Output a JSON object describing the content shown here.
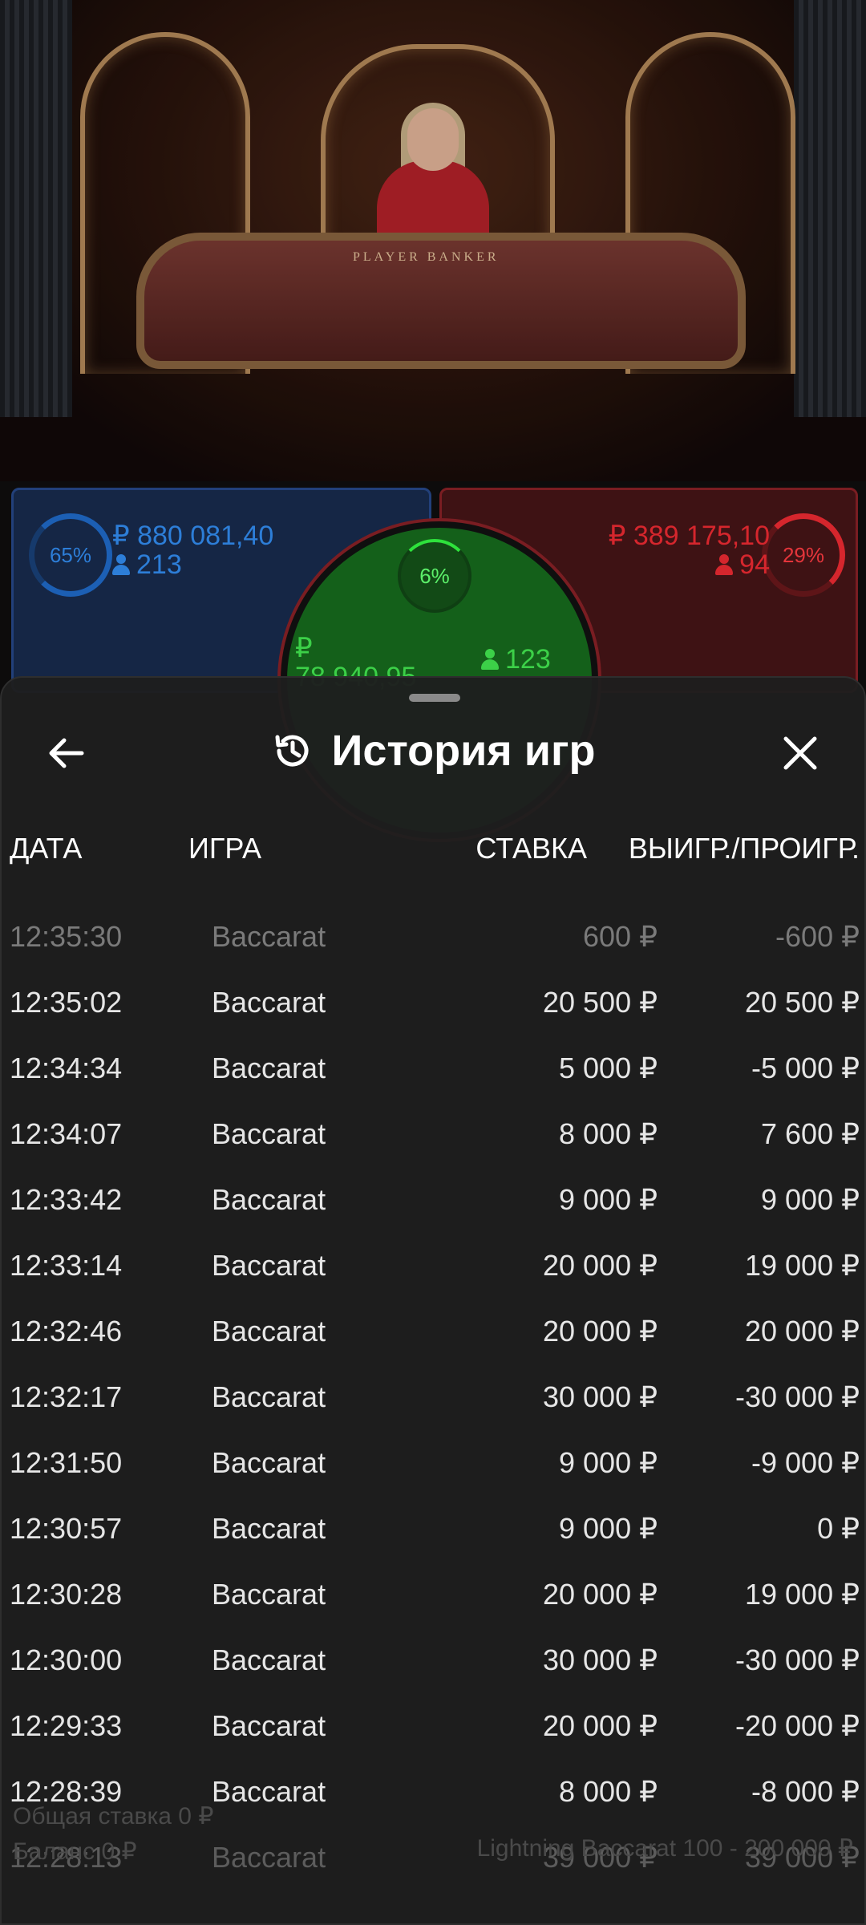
{
  "stream": {
    "table_label": "PLAYER    BANKER"
  },
  "bets": {
    "player": {
      "percent": "65%",
      "amount": "₽ 880 081,40",
      "players": "213",
      "color": "#2d7ed8"
    },
    "banker": {
      "percent": "29%",
      "amount": "₽ 389 175,10",
      "players": "94",
      "color": "#d5262d"
    },
    "tie": {
      "percent": "6%",
      "amount_currency": "₽",
      "amount": "78 940,95",
      "players": "123",
      "color": "#3cd048"
    }
  },
  "sheet": {
    "title": "История игр",
    "back_icon": "arrow-left-icon",
    "history_icon": "history-icon",
    "close_icon": "close-icon",
    "columns": {
      "date": "ДАТА",
      "game": "ИГРА",
      "bet": "СТАВКА",
      "result": "ВЫИГР./ПРОИГР."
    },
    "rows": [
      {
        "time": "12:35:30",
        "game": "Baccarat",
        "bet": "600 ₽",
        "result": "-600 ₽"
      },
      {
        "time": "12:35:02",
        "game": "Baccarat",
        "bet": "20 500 ₽",
        "result": "20 500 ₽"
      },
      {
        "time": "12:34:34",
        "game": "Baccarat",
        "bet": "5 000 ₽",
        "result": "-5 000 ₽"
      },
      {
        "time": "12:34:07",
        "game": "Baccarat",
        "bet": "8 000 ₽",
        "result": "7 600 ₽"
      },
      {
        "time": "12:33:42",
        "game": "Baccarat",
        "bet": "9 000 ₽",
        "result": "9 000 ₽"
      },
      {
        "time": "12:33:14",
        "game": "Baccarat",
        "bet": "20 000 ₽",
        "result": "19 000 ₽"
      },
      {
        "time": "12:32:46",
        "game": "Baccarat",
        "bet": "20 000 ₽",
        "result": "20 000 ₽"
      },
      {
        "time": "12:32:17",
        "game": "Baccarat",
        "bet": "30 000 ₽",
        "result": "-30 000 ₽"
      },
      {
        "time": "12:31:50",
        "game": "Baccarat",
        "bet": "9 000 ₽",
        "result": "-9 000 ₽"
      },
      {
        "time": "12:30:57",
        "game": "Baccarat",
        "bet": "9 000 ₽",
        "result": "0 ₽"
      },
      {
        "time": "12:30:28",
        "game": "Baccarat",
        "bet": "20 000 ₽",
        "result": "19 000 ₽"
      },
      {
        "time": "12:30:00",
        "game": "Baccarat",
        "bet": "30 000 ₽",
        "result": "-30 000 ₽"
      },
      {
        "time": "12:29:33",
        "game": "Baccarat",
        "bet": "20 000 ₽",
        "result": "-20 000 ₽"
      },
      {
        "time": "12:28:39",
        "game": "Baccarat",
        "bet": "8 000 ₽",
        "result": "-8 000 ₽"
      },
      {
        "time": "12:28:13",
        "game": "Baccarat",
        "bet": "39 000 ₽",
        "result": "39 000 ₽"
      }
    ]
  },
  "footer": {
    "total_bet": "Общая ставка 0 ₽",
    "balance": "Баланс 0 ₽",
    "table_limits": "Lightning Baccarat 100 - 200 000 ₽"
  }
}
